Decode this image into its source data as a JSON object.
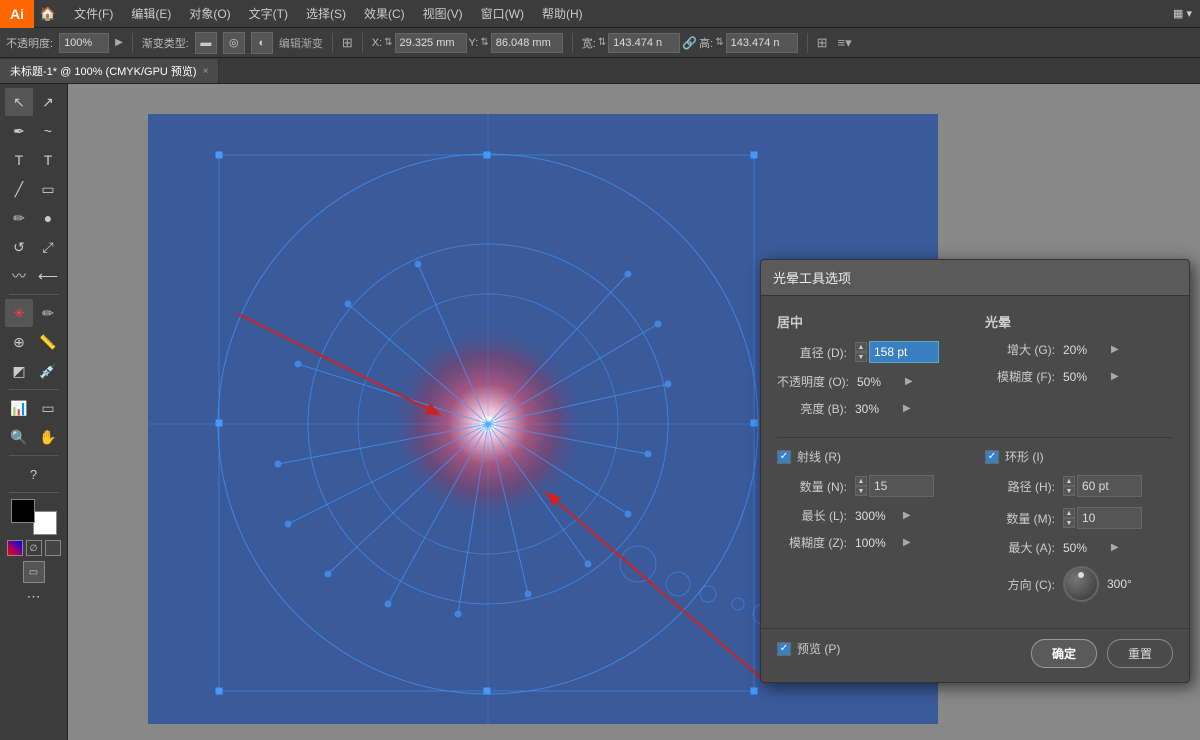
{
  "app": {
    "name": "Ai",
    "title": "未标题-1* @ 100% (CMYK/GPU 预览)"
  },
  "menu": {
    "items": [
      "文件(F)",
      "编辑(E)",
      "对象(O)",
      "文字(T)",
      "选择(S)",
      "效果(C)",
      "视图(V)",
      "窗口(W)",
      "帮助(H)"
    ]
  },
  "toolbar": {
    "label_opacity": "不透明度:",
    "value_opacity": "100%",
    "label_type": "渐变类型:",
    "label_edit": "编辑渐变",
    "x_label": "X:",
    "x_value": "29.325 mm",
    "y_label": "Y:",
    "y_value": "86.048 mm",
    "w_label": "宽:",
    "w_value": "143.474 n",
    "h_label": "高:",
    "h_value": "143.474 n"
  },
  "tab": {
    "label": "未标题-1* @ 100% (CMYK/GPU 预览)",
    "close": "×"
  },
  "left_toolbar": {
    "tools": [
      "↖",
      "↔",
      "✏",
      "♦",
      "T",
      "⬡",
      "◎",
      "🖐",
      "🔍",
      "?",
      "⊞",
      "⬛"
    ]
  },
  "dialog": {
    "title": "光晕工具选项",
    "section_center": "居中",
    "section_halo": "光晕",
    "diameter_label": "直径 (D):",
    "diameter_value": "158 pt",
    "opacity_label": "不透明度 (O):",
    "opacity_value": "50%",
    "brightness_label": "亮度 (B):",
    "brightness_value": "30%",
    "halo_grow_label": "增大 (G):",
    "halo_grow_value": "20%",
    "halo_fuzz_label": "模糊度 (F):",
    "halo_fuzz_value": "50%",
    "rays_label": "射线 (R)",
    "rays_checked": true,
    "rays_count_label": "数量 (N):",
    "rays_count_value": "15",
    "rays_length_label": "最长 (L):",
    "rays_length_value": "300%",
    "rays_fuzz_label": "模糊度 (Z):",
    "rays_fuzz_value": "100%",
    "rings_label": "环形 (I)",
    "rings_checked": true,
    "rings_path_label": "路径 (H):",
    "rings_path_value": "60 pt",
    "rings_count_label": "数量 (M):",
    "rings_count_value": "10",
    "rings_max_label": "最大 (A):",
    "rings_max_value": "50%",
    "direction_label": "方向 (C):",
    "direction_value": "300°",
    "preview_label": "预览 (P)",
    "preview_checked": true,
    "btn_ok": "确定",
    "btn_reset": "重置"
  },
  "colors": {
    "accent_blue": "#3a7fc1",
    "dialog_bg": "#4a4a4a",
    "canvas_bg": "#3a5a9a",
    "flare_pink": "#cc6677",
    "flare_glow": "#ff99aa"
  }
}
